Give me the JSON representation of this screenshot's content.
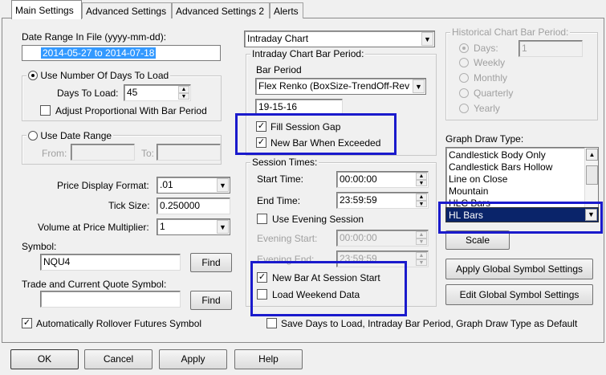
{
  "tabs": [
    "Main Settings",
    "Advanced Settings",
    "Advanced Settings 2",
    "Alerts"
  ],
  "date_range": {
    "label": "Date Range In File (yyyy-mm-dd):",
    "value": "2014-05-27 to 2014-07-18"
  },
  "num_days": {
    "label": "Use Number Of Days To Load",
    "days_label": "Days To Load:",
    "days_value": "45",
    "adjust_label": "Adjust Proportional With Bar Period"
  },
  "date_range_opt": {
    "label": "Use Date Range",
    "from_label": "From:",
    "to_label": "To:",
    "from_value": "",
    "to_value": ""
  },
  "price_format": {
    "label": "Price Display Format:",
    "value": ".01"
  },
  "tick_size": {
    "label": "Tick Size:",
    "value": "0.250000"
  },
  "volume_mult": {
    "label": "Volume at Price Multiplier:",
    "value": "1"
  },
  "symbol": {
    "label": "Symbol:",
    "value": "NQU4",
    "find": "Find"
  },
  "quote_symbol": {
    "label": "Trade and Current Quote Symbol:",
    "value": "",
    "find": "Find"
  },
  "auto_rollover": {
    "label": "Automatically Rollover Futures Symbol",
    "checked": true
  },
  "chart_type": {
    "value": "Intraday Chart"
  },
  "intraday": {
    "title": "Intraday Chart Bar Period:",
    "bar_period_label": "Bar Period",
    "bar_period_value": "Flex Renko (BoxSize-TrendOff-Rev",
    "bar_period_param": "19-15-16",
    "fill_gap": "Fill Session Gap",
    "new_bar_exceeded": "New Bar When Exceeded"
  },
  "session": {
    "title": "Session Times:",
    "start_label": "Start Time:",
    "start_value": "00:00:00",
    "end_label": "End Time:",
    "end_value": "23:59:59",
    "evening_label": "Use Evening Session",
    "evening_start_label": "Evening Start:",
    "evening_start_value": "00:00:00",
    "evening_end_label": "Evening End:",
    "evening_end_value": "23:59:59",
    "new_bar_session": "New Bar At Session Start",
    "load_weekend": "Load Weekend Data"
  },
  "historical": {
    "title": "Historical Chart Bar Period:",
    "options": [
      "Days:",
      "Weekly",
      "Monthly",
      "Quarterly",
      "Yearly"
    ],
    "days_value": "1"
  },
  "graph_draw": {
    "label": "Graph Draw Type:",
    "items": [
      "Candlestick Body Only",
      "Candlestick Bars Hollow",
      "Line on Close",
      "Mountain",
      "HLC Bars"
    ],
    "selected": "HL Bars"
  },
  "buttons": {
    "scale": "Scale",
    "apply_global": "Apply Global Symbol Settings",
    "edit_global": "Edit Global Symbol Settings",
    "ok": "OK",
    "cancel": "Cancel",
    "apply": "Apply",
    "help": "Help"
  },
  "save_days": "Save Days to Load, Intraday Bar Period, Graph Draw Type as Default",
  "colors": {
    "highlight": "#1a1acc",
    "selection": "#0a246a",
    "field_selection": "#3399ff"
  }
}
